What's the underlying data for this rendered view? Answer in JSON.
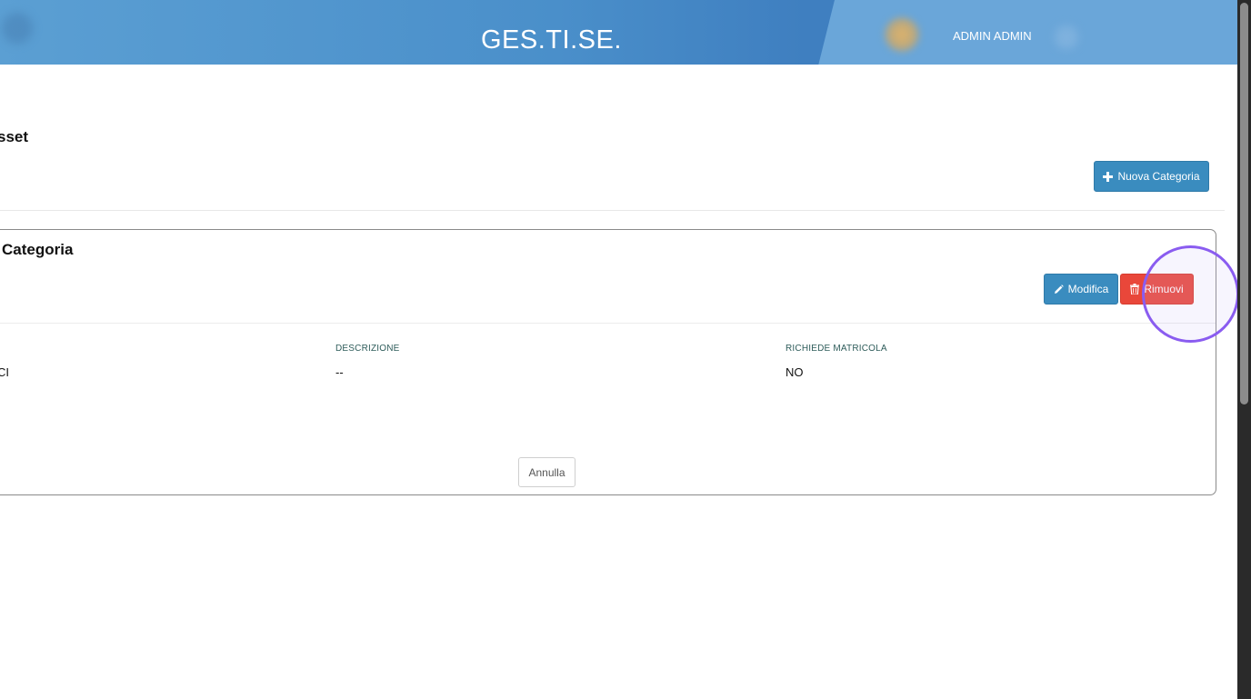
{
  "header": {
    "app_title": "GES.TI.SE.",
    "user_name": "ADMIN ADMIN"
  },
  "page": {
    "title": "sset",
    "new_category_label": "Nuova Categoria"
  },
  "panel": {
    "title": "Categoria",
    "edit_label": "Modifica",
    "remove_label": "Rimuovi",
    "columns": [
      {
        "label": "",
        "value": "CI"
      },
      {
        "label": "DESCRIZIONE",
        "value": "--"
      },
      {
        "label": "RICHIEDE MATRICOLA",
        "value": "NO"
      }
    ],
    "cancel_label": "Annulla"
  },
  "colors": {
    "header": "#4a8fca",
    "primary": "#3a8cbf",
    "danger": "#e9473a",
    "highlight": "#8a5cf0"
  },
  "icons": {
    "new": "plus-icon",
    "edit": "pencil-icon",
    "remove": "trash-icon"
  }
}
